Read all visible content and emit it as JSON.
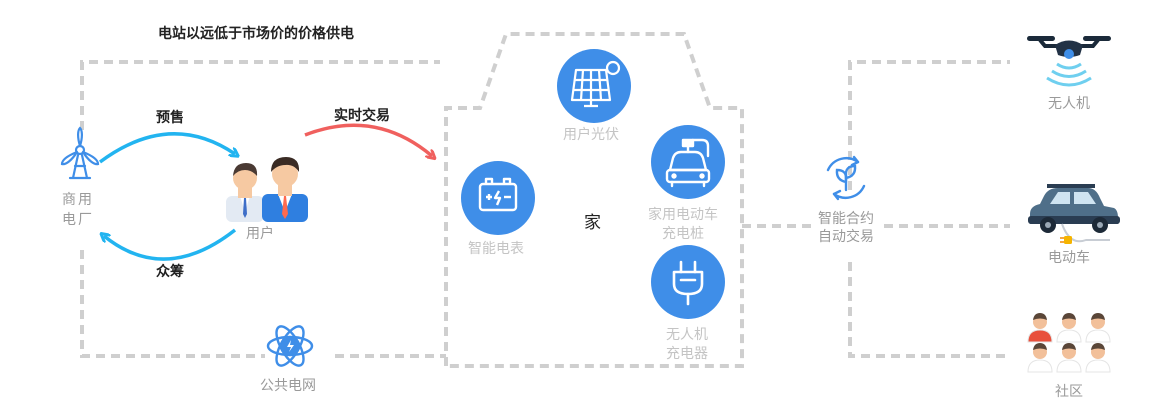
{
  "top_note": "电站以远低于市场价的价格供电",
  "arrows": {
    "presale": "预售",
    "crowdfund": "众筹",
    "realtime": "实时交易"
  },
  "nodes": {
    "plant": "商用\n电厂",
    "users": "用户",
    "grid": "公共电网",
    "home": "家",
    "solar": "用户光伏",
    "meter": "智能电表",
    "ev_charger": "家用电动车\n充电桩",
    "drone_charger": "无人机\n充电器",
    "contract": "智能合约\n自动交易",
    "drone": "无人机",
    "ev": "电动车",
    "community": "社区"
  },
  "colors": {
    "blue_icon": "#3f8ee8",
    "arrow_blue": "#22b4f0",
    "arrow_red": "#f0605e",
    "dash": "#cfcfcf"
  }
}
